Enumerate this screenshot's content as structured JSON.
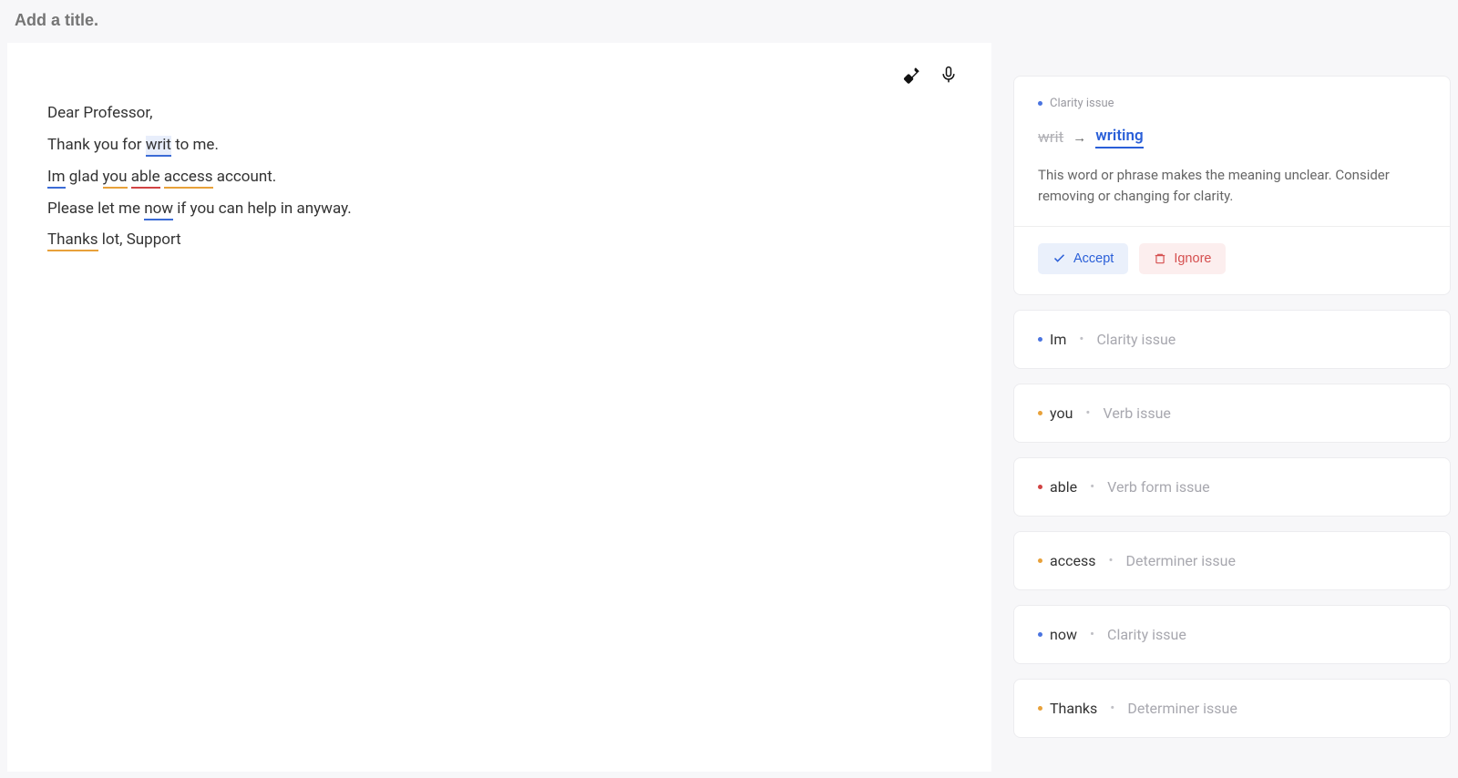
{
  "title_placeholder": "Add a title.",
  "editor": {
    "line1_prefix": "Dear Professor,",
    "line2_prefix": "Thank you for ",
    "line2_word1": "writ",
    "line2_suffix": " to me.",
    "line3_word1": "Im",
    "line3_mid1": " glad ",
    "line3_word2": "you",
    "line3_mid2": " ",
    "line3_word3": "able",
    "line3_mid3": " ",
    "line3_word4": "access",
    "line3_suffix": " account.",
    "line4_prefix": "Please let me ",
    "line4_word1": "now",
    "line4_suffix": " if you can help in anyway.",
    "line5_word1": "Thanks",
    "line5_suffix": " lot, Support"
  },
  "expanded": {
    "issue_type": "Clarity issue",
    "original": "writ",
    "replacement": "writing",
    "explanation": "This word or phrase makes the meaning unclear. Consider removing or changing for clarity.",
    "accept_label": "Accept",
    "ignore_label": "Ignore"
  },
  "collapsed": [
    {
      "word": "Im",
      "type": "Clarity issue",
      "color": "blue"
    },
    {
      "word": "you",
      "type": "Verb issue",
      "color": "orange"
    },
    {
      "word": "able",
      "type": "Verb form issue",
      "color": "red"
    },
    {
      "word": "access",
      "type": "Determiner issue",
      "color": "orange"
    },
    {
      "word": "now",
      "type": "Clarity issue",
      "color": "blue"
    },
    {
      "word": "Thanks",
      "type": "Determiner issue",
      "color": "orange"
    }
  ]
}
